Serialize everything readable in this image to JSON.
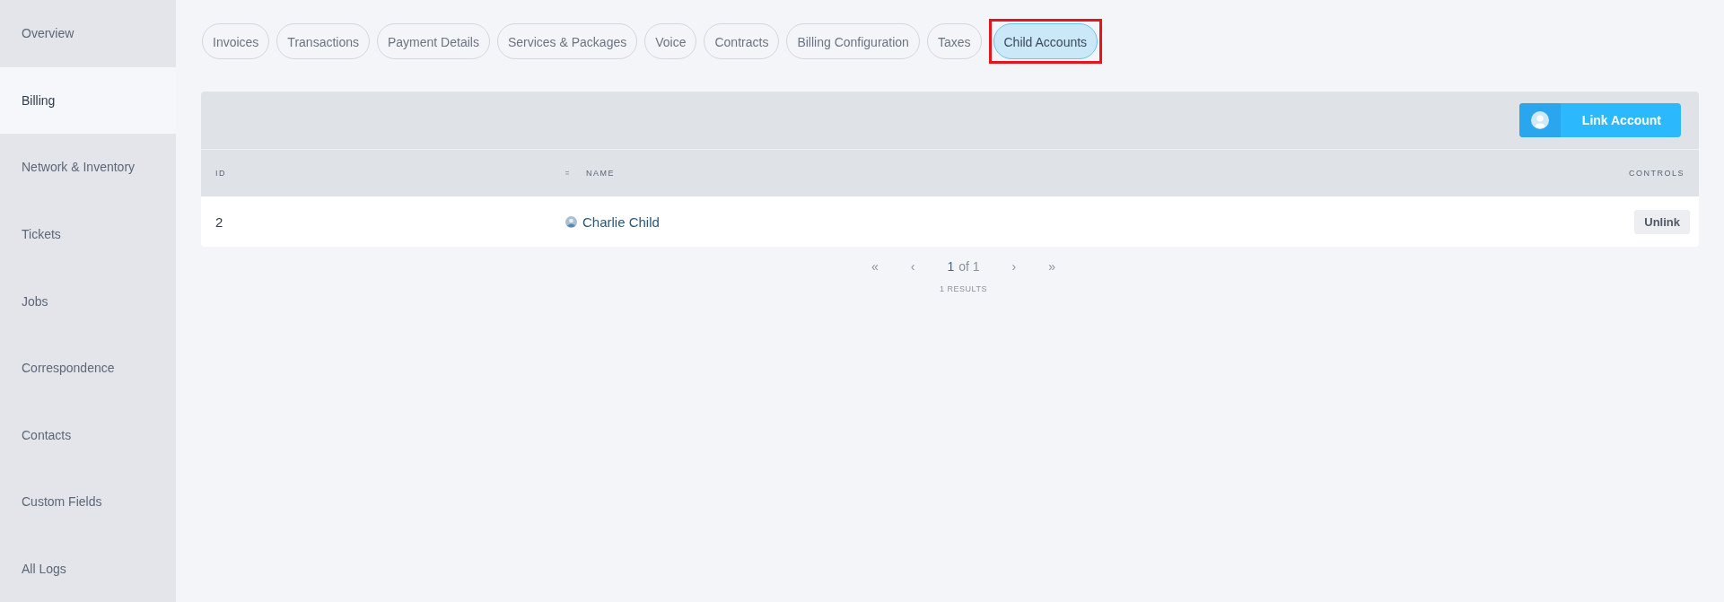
{
  "sidebar": {
    "items": [
      {
        "label": "Overview",
        "selected": false
      },
      {
        "label": "Billing",
        "selected": true
      },
      {
        "label": "Network & Inventory",
        "selected": false
      },
      {
        "label": "Tickets",
        "selected": false
      },
      {
        "label": "Jobs",
        "selected": false
      },
      {
        "label": "Correspondence",
        "selected": false
      },
      {
        "label": "Contacts",
        "selected": false
      },
      {
        "label": "Custom Fields",
        "selected": false
      },
      {
        "label": "All Logs",
        "selected": false
      }
    ]
  },
  "tabs": [
    {
      "label": "Invoices",
      "selected": false,
      "highlighted": false
    },
    {
      "label": "Transactions",
      "selected": false,
      "highlighted": false
    },
    {
      "label": "Payment Details",
      "selected": false,
      "highlighted": false
    },
    {
      "label": "Services & Packages",
      "selected": false,
      "highlighted": false
    },
    {
      "label": "Voice",
      "selected": false,
      "highlighted": false
    },
    {
      "label": "Contracts",
      "selected": false,
      "highlighted": false
    },
    {
      "label": "Billing Configuration",
      "selected": false,
      "highlighted": false
    },
    {
      "label": "Taxes",
      "selected": false,
      "highlighted": false
    },
    {
      "label": "Child Accounts",
      "selected": true,
      "highlighted": true
    }
  ],
  "toolbar": {
    "link_button": "Link Account"
  },
  "table": {
    "columns": [
      "ID",
      "NAME",
      "CONTROLS"
    ],
    "rows": [
      {
        "id": "2",
        "name": "Charlie Child",
        "action": "Unlink"
      }
    ]
  },
  "pagination": {
    "first": "«",
    "prev": "‹",
    "current": "1",
    "of": "of 1",
    "next": "›",
    "last": "»",
    "results": "1 RESULTS"
  }
}
